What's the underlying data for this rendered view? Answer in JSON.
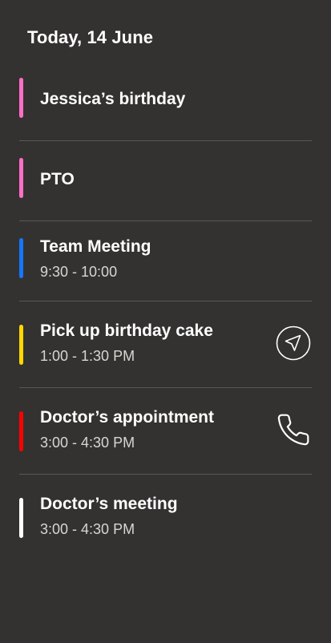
{
  "header": {
    "title": "Today, 14 June"
  },
  "events": [
    {
      "title": "Jessica’s birthday",
      "time": "",
      "color": "#ff6ec7"
    },
    {
      "title": "PTO",
      "time": "",
      "color": "#ff6ec7"
    },
    {
      "title": "Team Meeting",
      "time": "9:30 - 10:00",
      "color": "#1677ff"
    },
    {
      "title": "Pick up birthday cake",
      "time": "1:00 - 1:30 PM",
      "color": "#ffd800",
      "action_icon": "navigate-arrow-icon"
    },
    {
      "title": "Doctor’s appointment",
      "time": "3:00 - 4:30 PM",
      "color": "#ff0000",
      "action_icon": "phone-icon"
    },
    {
      "title": "Doctor’s meeting",
      "time": "3:00 - 4:30 PM",
      "color": "#ffffff"
    }
  ]
}
